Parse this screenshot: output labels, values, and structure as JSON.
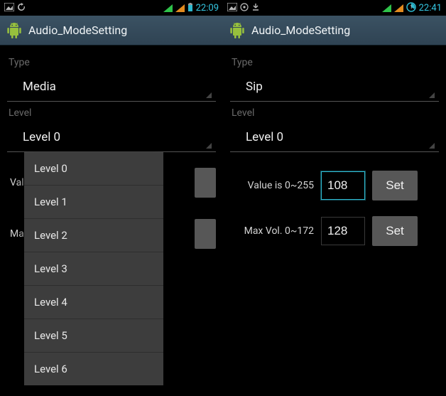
{
  "left": {
    "statusbar": {
      "left_icons": [
        "image-icon",
        "refresh-icon"
      ],
      "clock": "22:09"
    },
    "appbar": {
      "title": "Audio_ModeSetting"
    },
    "type_label": "Type",
    "type_value": "Media",
    "level_label": "Level",
    "level_value": "Level 0",
    "dropdown_items": [
      "Level 0",
      "Level 1",
      "Level 2",
      "Level 3",
      "Level 4",
      "Level 5",
      "Level 6"
    ],
    "row1_label_partial": "Valu",
    "row2_label_partial": "Max "
  },
  "right": {
    "statusbar": {
      "left_icons": [
        "image-icon",
        "target-icon",
        "download-icon"
      ],
      "clock": "22:41"
    },
    "appbar": {
      "title": "Audio_ModeSetting"
    },
    "type_label": "Type",
    "type_value": "Sip",
    "level_label": "Level",
    "level_value": "Level 0",
    "row1_label": "Value is 0~255",
    "row1_value": "108",
    "row2_label": "Max Vol. 0~172",
    "row2_value": "128",
    "set_btn": "Set"
  }
}
